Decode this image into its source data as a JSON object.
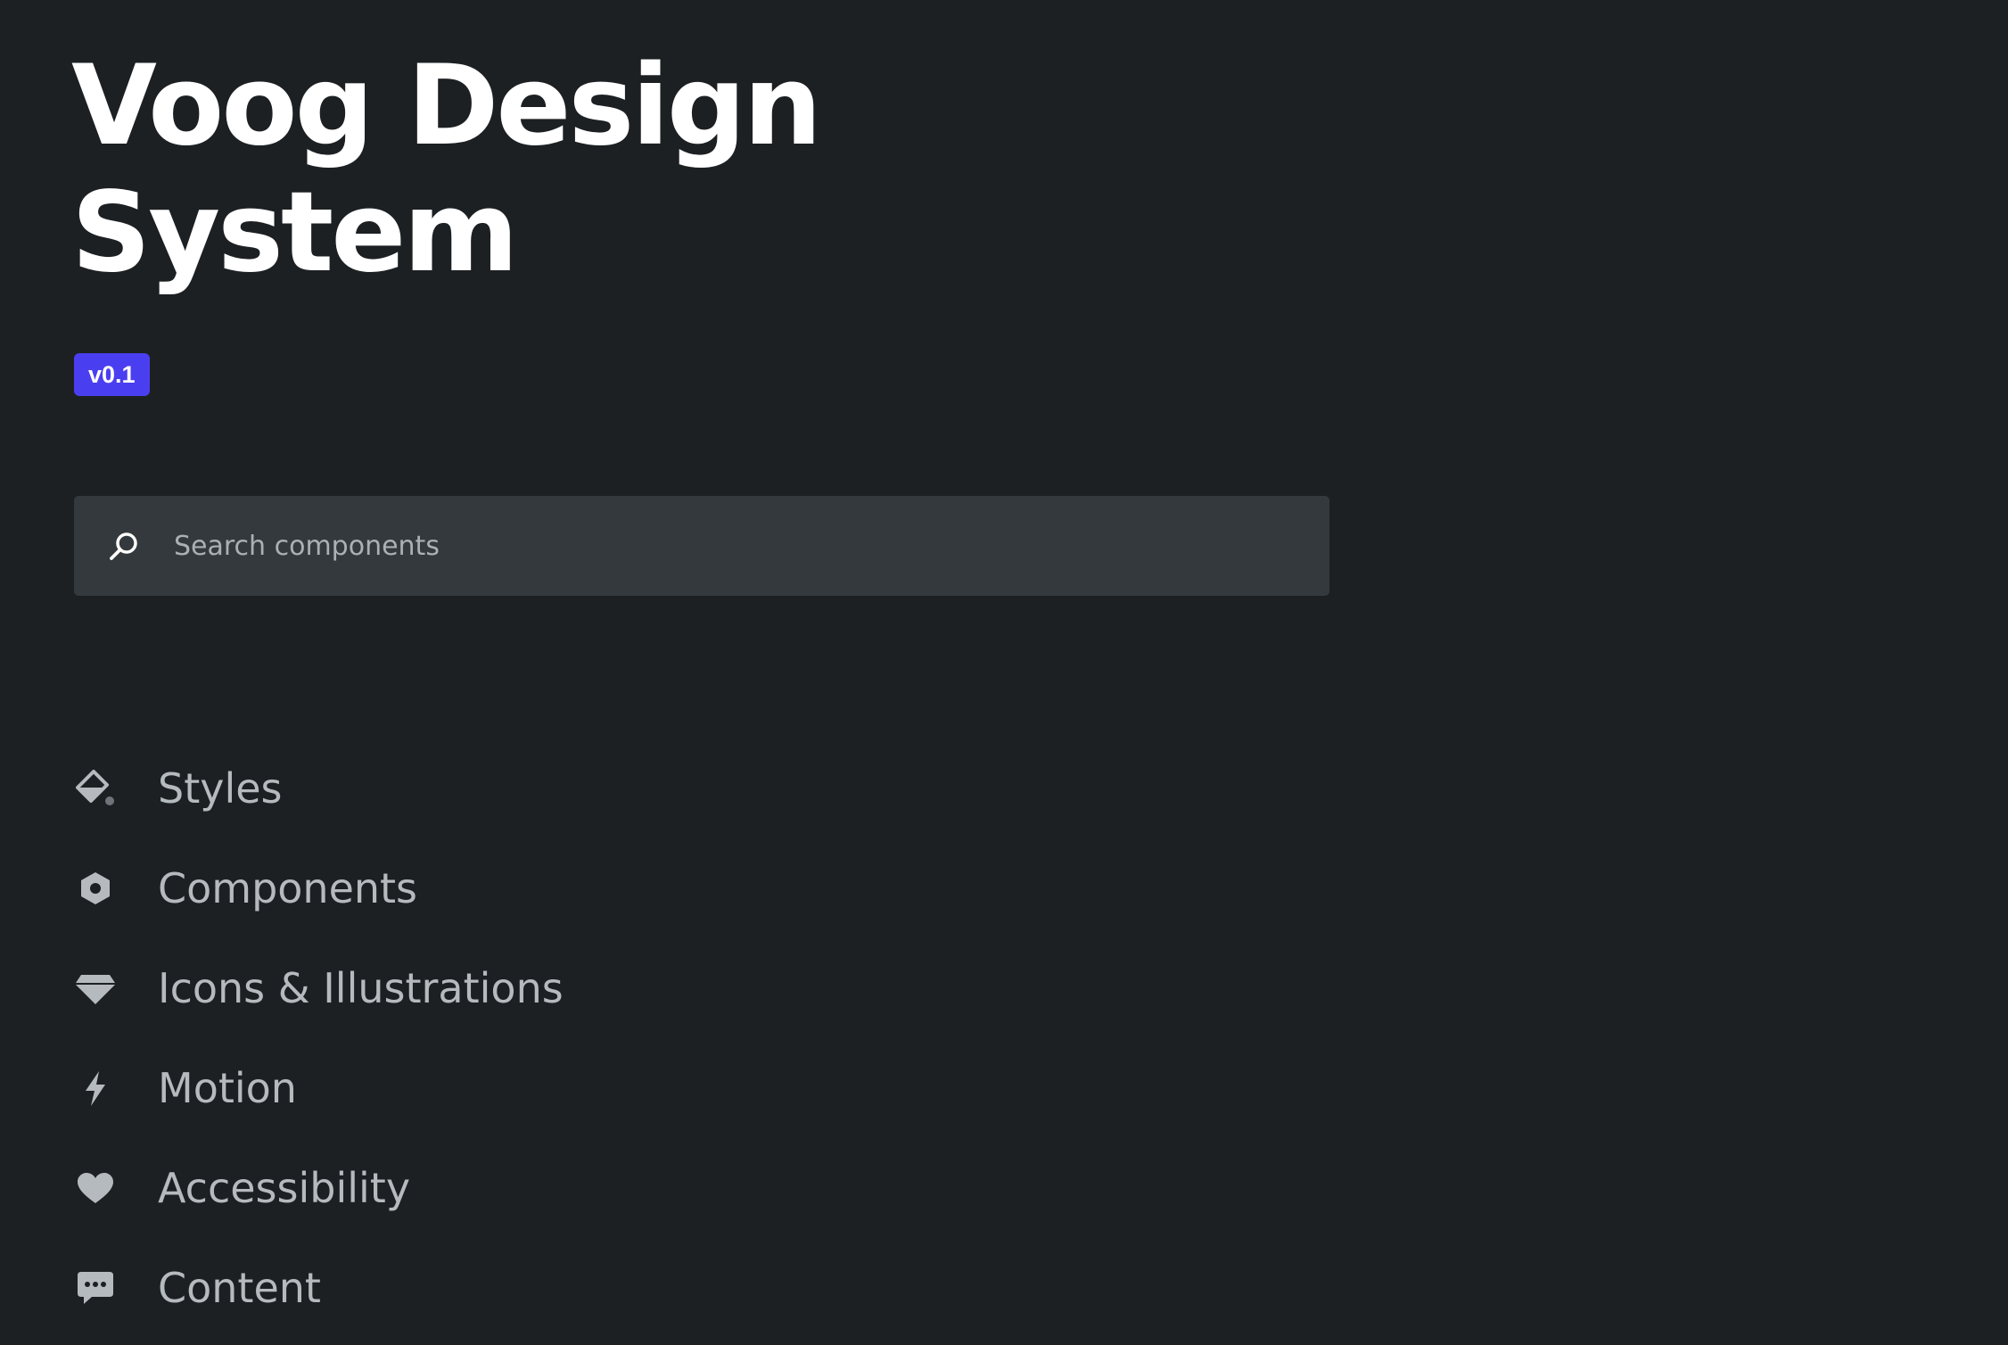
{
  "header": {
    "title_line1": "Voog Design",
    "title_line2": "System",
    "version": "v0.1"
  },
  "search": {
    "value": "",
    "placeholder": "Search components",
    "icon": "search-icon"
  },
  "nav": {
    "items": [
      {
        "label": "Styles",
        "icon": "paint-bucket-icon"
      },
      {
        "label": "Components",
        "icon": "hexagon-icon"
      },
      {
        "label": "Icons & Illustrations",
        "icon": "diamond-icon"
      },
      {
        "label": "Motion",
        "icon": "lightning-bolt-icon"
      },
      {
        "label": "Accessibility",
        "icon": "heart-icon"
      },
      {
        "label": "Content",
        "icon": "chat-bubble-icon"
      }
    ]
  },
  "colors": {
    "background": "#1c2023",
    "badge": "#4a3ff0",
    "search_background": "#34393d",
    "nav_text": "#b5babe",
    "title_text": "#ffffff"
  }
}
